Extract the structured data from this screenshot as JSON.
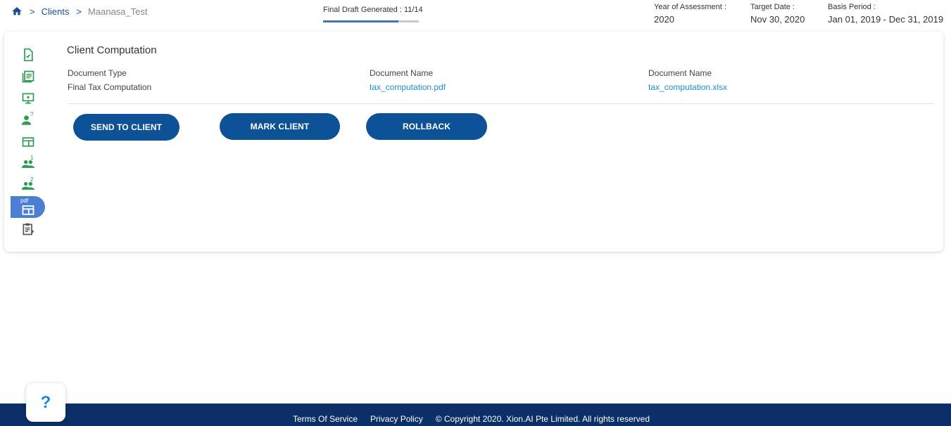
{
  "breadcrumb": {
    "home_icon": "home-icon",
    "items": [
      "Clients",
      "Maanasa_Test"
    ],
    "separator": ">"
  },
  "progress": {
    "label": "Final Draft Generated : 11/14",
    "fraction": 0.786
  },
  "meta": {
    "year_label": "Year of Assessment :",
    "year_value": "2020",
    "target_label": "Target Date :",
    "target_value": "Nov 30, 2020",
    "basis_label": "Basis Period :",
    "basis_value": "Jan 01, 2019 - Dec 31, 2019"
  },
  "sidenav": {
    "items": [
      {
        "icon": "document-check-icon"
      },
      {
        "icon": "document-list-icon"
      },
      {
        "icon": "monitor-icon"
      },
      {
        "icon": "user-question-icon",
        "sup": "?"
      },
      {
        "icon": "window-icon"
      },
      {
        "icon": "group-icon",
        "sup": "1"
      },
      {
        "icon": "group-icon",
        "sup": "2"
      },
      {
        "icon": "pdf-window-icon",
        "tag": "pdf",
        "active": true
      },
      {
        "icon": "clipboard-icon"
      }
    ],
    "sup_q": "?",
    "sup_1": "1",
    "sup_2": "2",
    "pdf_tag": "pdf"
  },
  "main": {
    "title": "Client Computation",
    "columns": [
      {
        "header": "Document Type",
        "value": "Final Tax Computation"
      },
      {
        "header": "Document Name",
        "value": "tax_computation.pdf"
      },
      {
        "header": "Document Name",
        "value": "tax_computation.xlsx"
      }
    ],
    "buttons": {
      "send": "SEND TO CLIENT",
      "mark": "MARK CLIENT",
      "rollback": "ROLLBACK"
    }
  },
  "help": {
    "label": "?"
  },
  "footer": {
    "terms": "Terms Of Service",
    "privacy": "Privacy Policy",
    "copyright": "© Copyright 2020. Xion.AI Pte Limited. All rights reserved"
  },
  "colors": {
    "accent": "#0d5297",
    "link": "#1f8fd3",
    "icon_green": "#2e9b52",
    "footer": "#0b3067",
    "active_nav": "#4a7fd1"
  }
}
